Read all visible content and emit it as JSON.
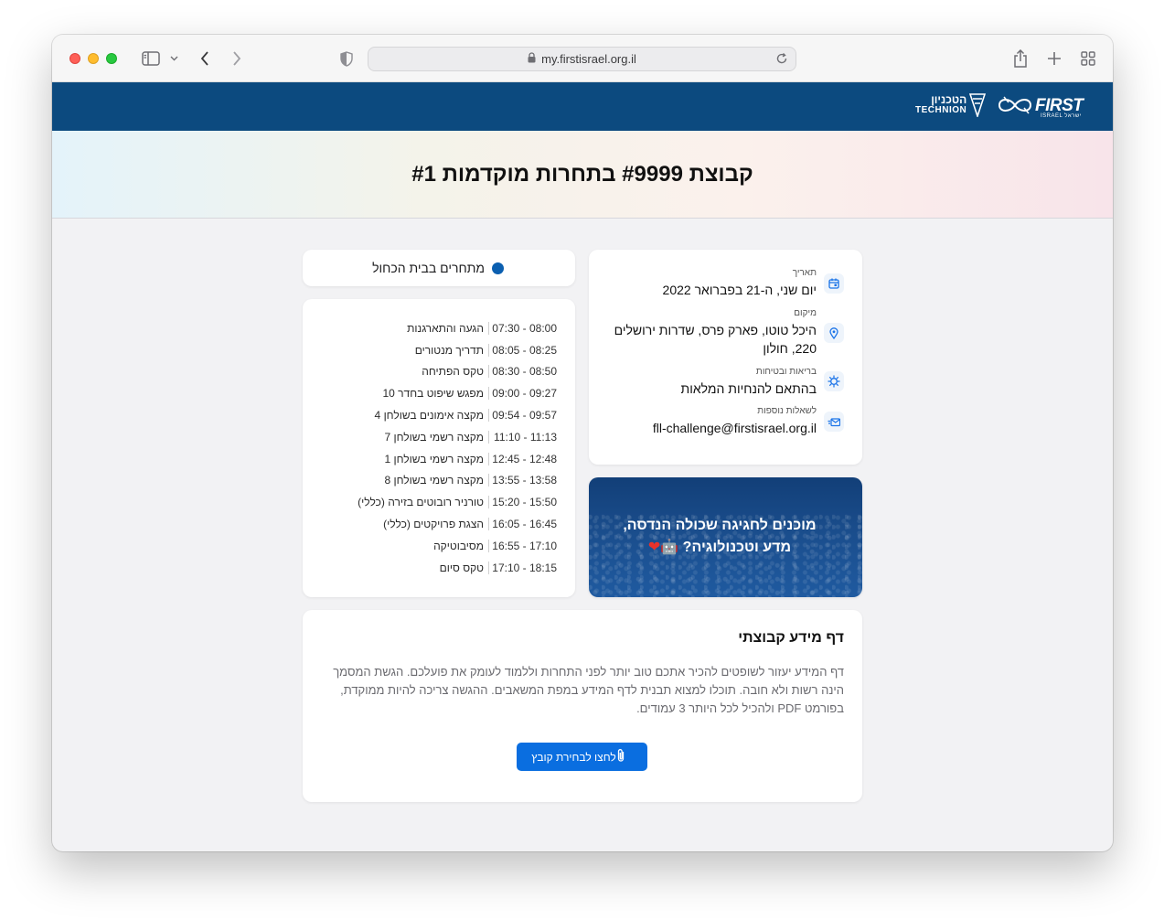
{
  "browser": {
    "url": "my.firstisrael.org.il"
  },
  "site": {
    "logo_technion_he": "הטכניון",
    "logo_technion_en": "TECHNION",
    "logo_first": "FIRST",
    "logo_first_sub": "ISRAEL ישראל"
  },
  "hero": {
    "title": "קבוצת #9999 בתחרות מוקדמות #1"
  },
  "info": {
    "date_label": "תאריך",
    "date_value": "יום שני, ה-21 בפברואר 2022",
    "location_label": "מיקום",
    "location_value": "היכל טוטו, פארק פרס, שדרות ירושלים 220, חולון",
    "safety_label": "בריאות ובטיחות",
    "safety_value": "בהתאם להנחיות המלאות",
    "contact_label": "לשאלות נוספות",
    "contact_value": "fll-challenge@firstisrael.org.il"
  },
  "status": {
    "label": "מתחרים בבית הכחול",
    "color": "#0b5fb0"
  },
  "schedule": [
    {
      "time": "08:00 - 07:30",
      "name": "הגעה והתארגנות"
    },
    {
      "time": "08:25 - 08:05",
      "name": "תדריך מנטורים"
    },
    {
      "time": "08:50 - 08:30",
      "name": "טקס הפתיחה"
    },
    {
      "time": "09:27 - 09:00",
      "name": "מפגש שיפוט בחדר 10"
    },
    {
      "time": "09:57 - 09:54",
      "name": "מקצה אימונים בשולחן 4"
    },
    {
      "time": "11:13 - 11:10",
      "name": "מקצה רשמי בשולחן 7"
    },
    {
      "time": "12:48 - 12:45",
      "name": "מקצה רשמי בשולחן 1"
    },
    {
      "time": "13:58 - 13:55",
      "name": "מקצה רשמי בשולחן 8"
    },
    {
      "time": "15:50 - 15:20",
      "name": "טורניר רובוטים בזירה (כללי)"
    },
    {
      "time": "16:45 - 16:05",
      "name": "הצגת פרויקטים (כללי)"
    },
    {
      "time": "17:10 - 16:55",
      "name": "מסיבוטיקה"
    },
    {
      "time": "18:15 - 17:10",
      "name": "טקס סיום"
    }
  ],
  "promo": {
    "line1": "מוכנים לחגיגה שכולה הנדסה,",
    "line2": "מדע וטכנולוגיה?",
    "emoji_robot": "🤖",
    "emoji_heart": "❤"
  },
  "team": {
    "title": "דף מידע קבוצתי",
    "description": "דף המידע יעזור לשופטים להכיר אתכם טוב יותר לפני התחרות וללמוד לעומק את פועלכם. הגשת המסמך הינה רשות ולא חובה. תוכלו למצוא תבנית לדף המידע במפת המשאבים. ההגשה צריכה להיות ממוקדת, בפורמט PDF ולהכיל לכל היותר 3 עמודים.",
    "upload_label": "לחצו לבחירת קובץ",
    "button_color": "#0a6ee0"
  }
}
